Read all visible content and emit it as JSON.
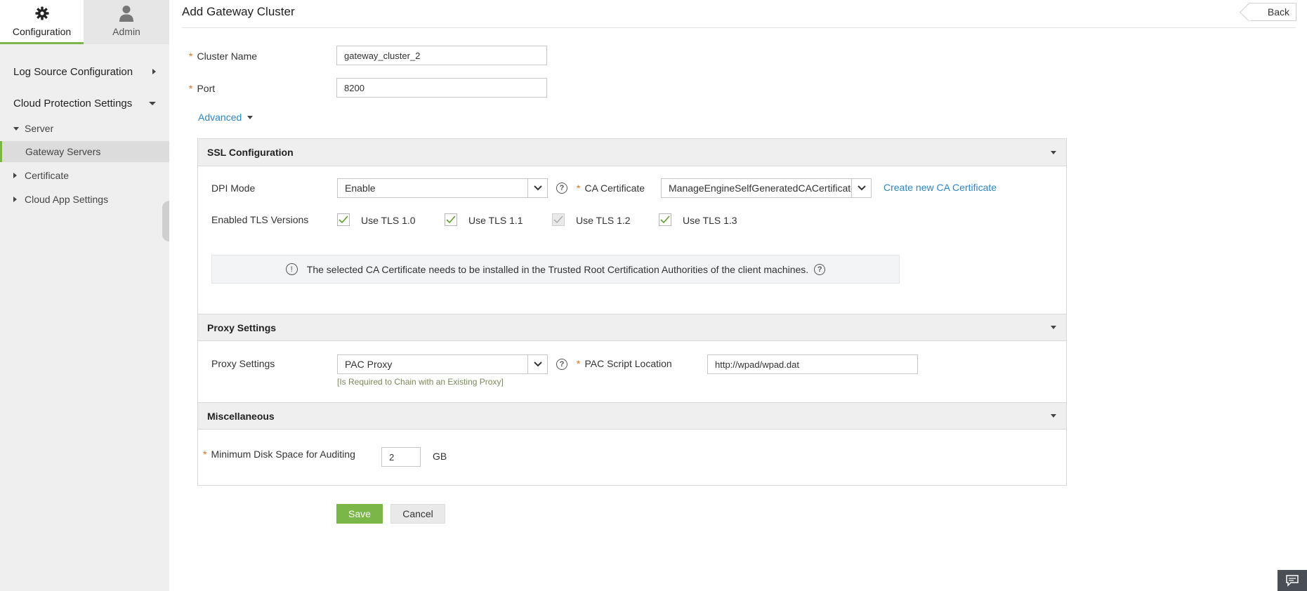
{
  "sidebar": {
    "tabs": [
      {
        "label": "Configuration",
        "icon": "gear-icon"
      },
      {
        "label": "Admin",
        "icon": "user-icon"
      }
    ],
    "sections": [
      {
        "label": "Log Source Configuration"
      },
      {
        "label": "Cloud Protection Settings"
      }
    ],
    "items": [
      {
        "label": "Server"
      },
      {
        "label": "Gateway Servers"
      },
      {
        "label": "Certificate"
      },
      {
        "label": "Cloud App Settings"
      }
    ]
  },
  "header": {
    "title": "Add Gateway Cluster",
    "back_label": "Back"
  },
  "form": {
    "required_mark": "*",
    "cluster_name": {
      "label": "Cluster Name",
      "value": "gateway_cluster_2"
    },
    "port": {
      "label": "Port",
      "value": "8200"
    },
    "advanced_label": "Advanced"
  },
  "ssl": {
    "title": "SSL Configuration",
    "dpi_label": "DPI Mode",
    "dpi_value": "Enable",
    "ca_label": "CA Certificate",
    "ca_value": "ManageEngineSelfGeneratedCACertificate",
    "create_ca_link": "Create new CA Certificate",
    "tls_label": "Enabled TLS Versions",
    "tls_options": [
      {
        "label": "Use TLS 1.0",
        "checked": true,
        "disabled": false
      },
      {
        "label": "Use TLS 1.1",
        "checked": true,
        "disabled": false
      },
      {
        "label": "Use TLS 1.2",
        "checked": true,
        "disabled": true
      },
      {
        "label": "Use TLS 1.3",
        "checked": true,
        "disabled": false
      }
    ],
    "info_text": "The selected CA Certificate needs to be installed in the Trusted Root Certification Authorities of the client machines."
  },
  "proxy": {
    "title": "Proxy Settings",
    "label": "Proxy Settings",
    "value": "PAC Proxy",
    "hint": "[Is Required to Chain with an Existing Proxy]",
    "pac_label": "PAC Script Location",
    "pac_value": "http://wpad/wpad.dat"
  },
  "misc": {
    "title": "Miscellaneous",
    "disk_label": "Minimum Disk Space for Auditing",
    "disk_value": "2",
    "disk_unit": "GB"
  },
  "actions": {
    "save": "Save",
    "cancel": "Cancel"
  },
  "colors": {
    "accent_green": "#7ab648",
    "link_blue": "#2a86c9",
    "required_orange": "#e8711c"
  }
}
